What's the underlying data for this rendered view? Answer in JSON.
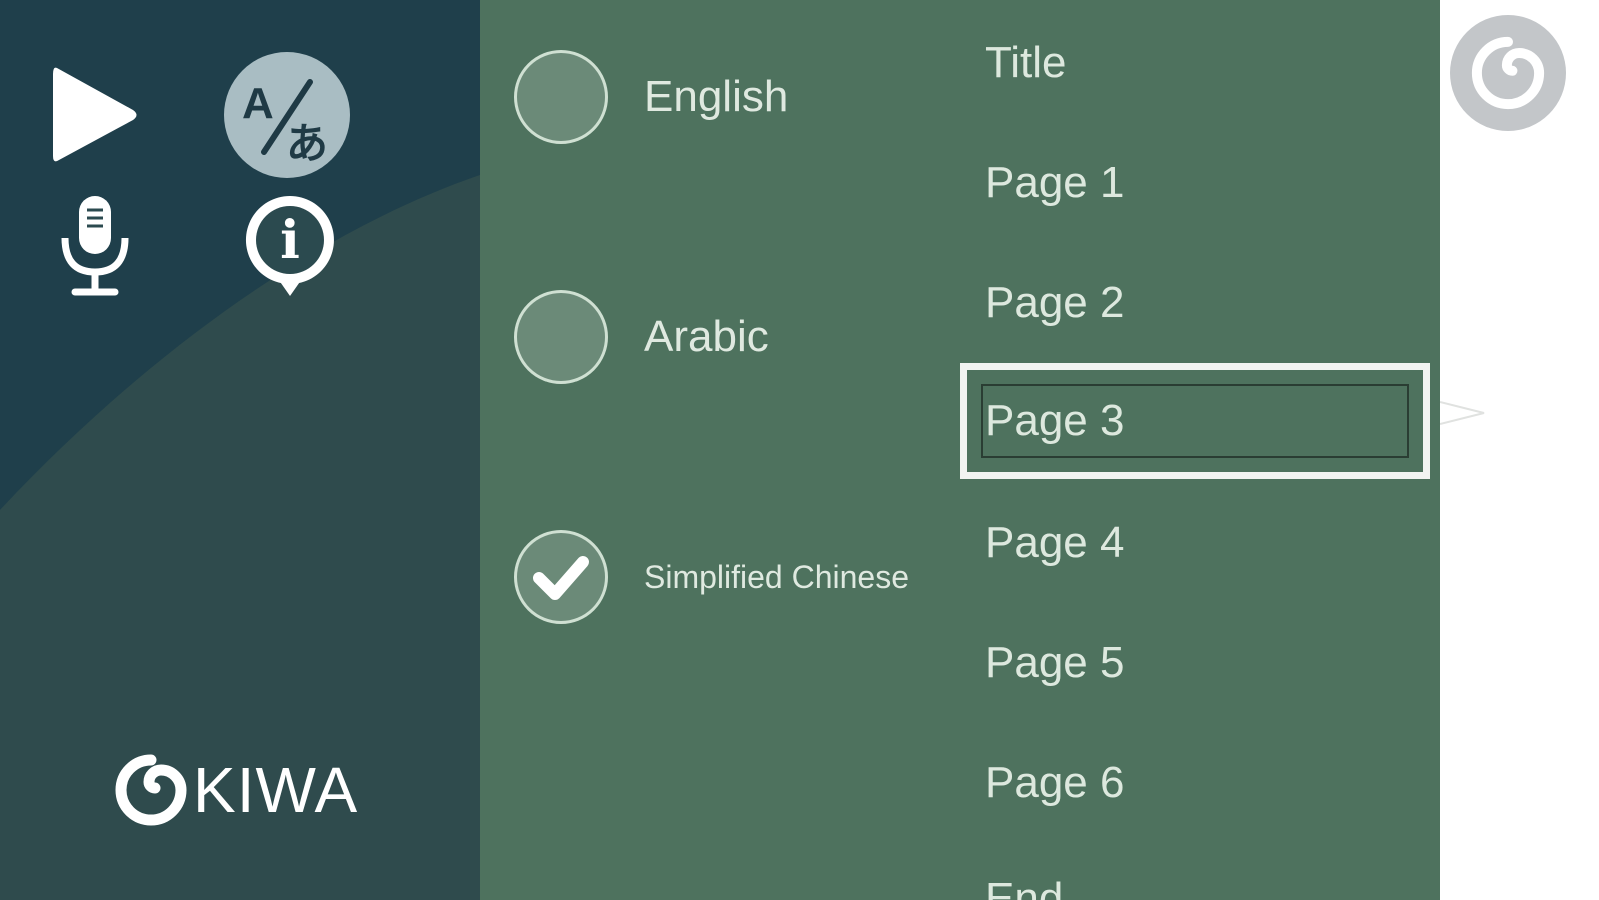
{
  "toolbar": {
    "play_icon": "play-icon",
    "translate_icon": "translate-icon",
    "translate_glyph_a": "A",
    "translate_glyph_b": "あ",
    "mic_icon": "microphone-icon",
    "info_icon": "info-icon",
    "info_glyph": "i"
  },
  "brand": {
    "name": "KIWA"
  },
  "languages": [
    {
      "label": "English",
      "selected": false
    },
    {
      "label": "Arabic",
      "selected": false
    },
    {
      "label": "Simplified Chinese",
      "selected": true
    }
  ],
  "pages": {
    "items": [
      "Title",
      "Page 1",
      "Page 2",
      "Page 3",
      "Page 4",
      "Page 5",
      "Page 6",
      "End"
    ],
    "selected_index": 3
  },
  "colors": {
    "left_panel": "#2c4a4f",
    "menu_panel": "#4e725e",
    "text": "#dde8de",
    "highlight_border": "#f2f4f2",
    "corner_button": "#c3c6c9"
  }
}
